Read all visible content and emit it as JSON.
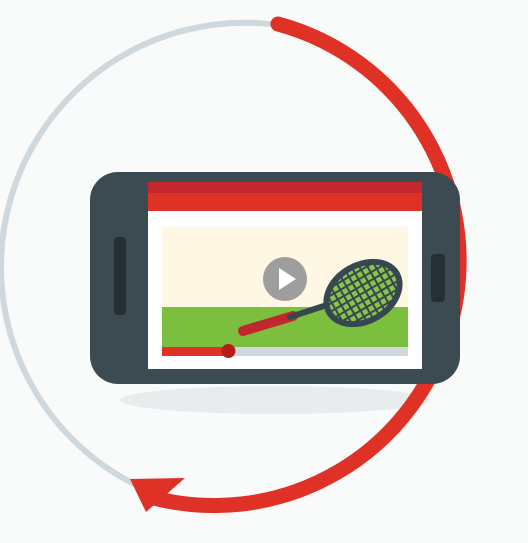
{
  "illustration": {
    "subject": "phone-video-rotation",
    "progress_ring": {
      "progress_fraction": 0.62,
      "progress_color": "#e03127",
      "track_color": "#cfd8dc"
    },
    "phone": {
      "body_color": "#3c4a52",
      "screen_header_color": "#e03127",
      "screen_header_dark": "#c1272d"
    },
    "video_player": {
      "sky_color": "#fdf7e3",
      "grass_color": "#7cbf3f",
      "play_button_color": "#9e9e9e",
      "progress_fraction": 0.27,
      "progress_color": "#e03127",
      "scrub_track_color": "#cfd8dc"
    },
    "tennis_racket": {
      "frame_color": "#37474f",
      "handle_color": "#c1272d",
      "strings_color": "#8bc34a"
    }
  }
}
